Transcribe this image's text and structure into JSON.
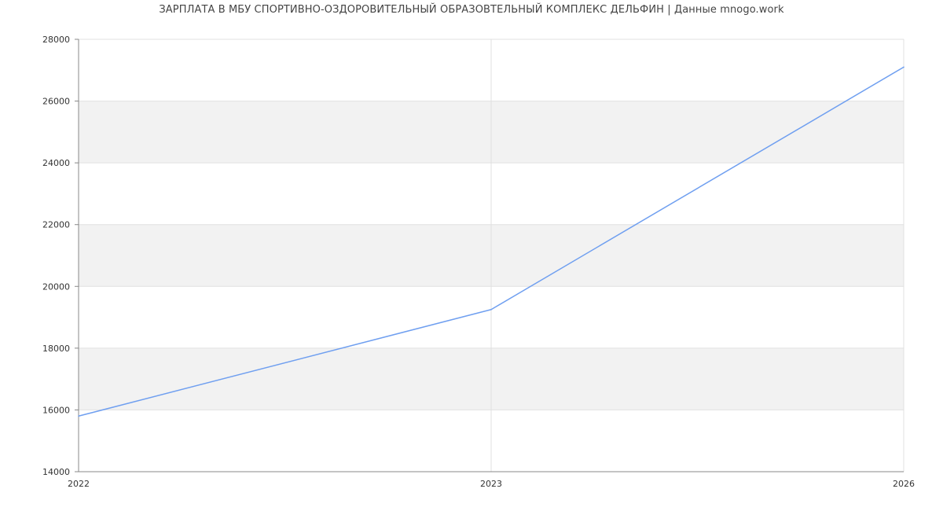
{
  "chart_data": {
    "type": "line",
    "title": "ЗАРПЛАТА В МБУ СПОРТИВНО-ОЗДОРОВИТЕЛЬНЫЙ ОБРАЗОВТЕЛЬНЫЙ КОМПЛЕКС ДЕЛЬФИН | Данные mnogo.work",
    "x": [
      "2022",
      "2023",
      "2026"
    ],
    "series": [
      {
        "values": [
          15800,
          19250,
          27100
        ],
        "color": "#6f9ff0"
      }
    ],
    "ylim": [
      14000,
      28000
    ],
    "yticks": [
      "14000",
      "16000",
      "18000",
      "20000",
      "22000",
      "24000",
      "26000",
      "28000"
    ],
    "xticks": [
      "2022",
      "2023",
      "2026"
    ],
    "grid": true,
    "band_color": "#f2f2f2",
    "grid_color": "#e0e0e0",
    "axis_color": "#888888"
  }
}
